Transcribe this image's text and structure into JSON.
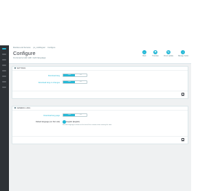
{
  "breadcrumb": [
    "Modules and Services",
    "ps_multilingual",
    "Configure"
  ],
  "page": {
    "title": "Configure",
    "subtitle": "Commerce Hub with multi language"
  },
  "toolbar": {
    "buttons": [
      {
        "label": "Back",
        "icon": "back-icon"
      },
      {
        "label": "Translate",
        "icon": "translate-icon"
      },
      {
        "label": "Check update",
        "icon": "refresh-icon"
      },
      {
        "label": "Manage hooks",
        "icon": "download-icon"
      }
    ]
  },
  "settings_panel": {
    "heading": "SETTINGS",
    "rows": [
      {
        "label": "Download lang",
        "on_label": "YES",
        "off_label": "NO",
        "value": "YES"
      },
      {
        "label": "Download lang on changes",
        "on_label": "YES",
        "off_label": "NO",
        "value": "YES"
      }
    ],
    "save_label": "Save"
  },
  "general_panel": {
    "heading": "GENERAL LANG",
    "toggle_row": {
      "label": "Download lang page",
      "on_label": "YES",
      "off_label": "NO",
      "value": "YES"
    },
    "radio_row": {
      "label": "Default language (on first visit)",
      "option": "English (English)",
      "hint": "Set what language is shown on first visit of the customer when entering the store."
    },
    "save_label": "Save"
  },
  "colors": {
    "accent": "#25b9d7",
    "sidebar": "#2e3236",
    "page_bg": "#eff1f2"
  }
}
